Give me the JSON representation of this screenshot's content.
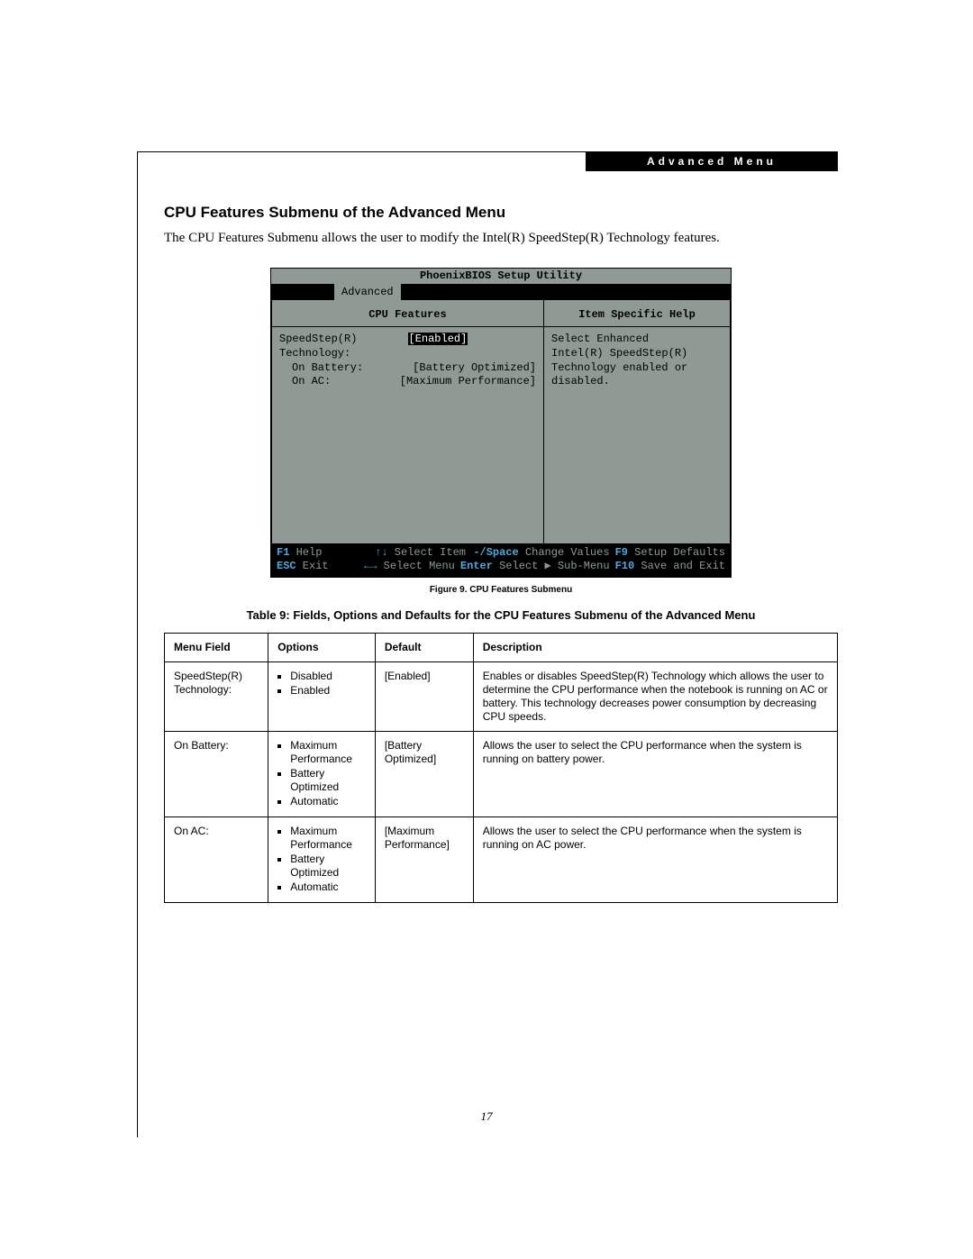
{
  "header_badge": "Advanced Menu",
  "heading": "CPU Features Submenu of the Advanced Menu",
  "intro": "The CPU Features Submenu allows the user to modify the Intel(R) SpeedStep(R) Technology features.",
  "bios": {
    "title": "PhoenixBIOS Setup Utility",
    "tab": "Advanced",
    "left_header": "CPU Features",
    "right_header": "Item Specific Help",
    "rows": [
      {
        "label": "SpeedStep(R) Technology:",
        "value": "[Enabled]",
        "selected": true
      },
      {
        "label": "On Battery:",
        "value": "[Battery Optimized]",
        "indent": true
      },
      {
        "label": "On AC:",
        "value": "[Maximum Performance]",
        "indent": true
      }
    ],
    "help_lines": [
      "Select Enhanced",
      "Intel(R) SpeedStep(R)",
      "Technology enabled or",
      "disabled."
    ],
    "footer": {
      "row1": [
        {
          "k": "F1",
          "t": "Help"
        },
        {
          "k": "↑↓",
          "t": "Select Item"
        },
        {
          "k": "-/Space",
          "t": "Change Values"
        },
        {
          "k": "F9",
          "t": "Setup Defaults"
        }
      ],
      "row2": [
        {
          "k": "ESC",
          "t": "Exit"
        },
        {
          "k": "←→",
          "t": "Select Menu"
        },
        {
          "k": "Enter",
          "t": "Select ▶ Sub-Menu"
        },
        {
          "k": "F10",
          "t": "Save and Exit"
        }
      ]
    }
  },
  "figure_caption": "Figure 9.   CPU Features Submenu",
  "table_title": "Table 9: Fields, Options and Defaults for the CPU Features Submenu of the Advanced Menu",
  "table": {
    "headers": [
      "Menu Field",
      "Options",
      "Default",
      "Description"
    ],
    "rows": [
      {
        "field": "SpeedStep(R) Technology:",
        "options": [
          "Disabled",
          "Enabled"
        ],
        "default": "[Enabled]",
        "desc": "Enables or disables SpeedStep(R) Technology which allows the user to determine the CPU performance when the notebook is running on AC or battery. This technology decreases power consumption by decreasing CPU speeds."
      },
      {
        "field": "On Battery:",
        "options": [
          "Maximum Performance",
          "Battery Optimized",
          "Automatic"
        ],
        "default": "[Battery Optimized]",
        "desc": "Allows the user to select the CPU performance when the system is running on battery power."
      },
      {
        "field": "On AC:",
        "options": [
          "Maximum Performance",
          "Battery Optimized",
          "Automatic"
        ],
        "default": "[Maximum Performance]",
        "desc": "Allows the user to select the CPU performance when the system is running on AC power."
      }
    ]
  },
  "page_number": "17"
}
